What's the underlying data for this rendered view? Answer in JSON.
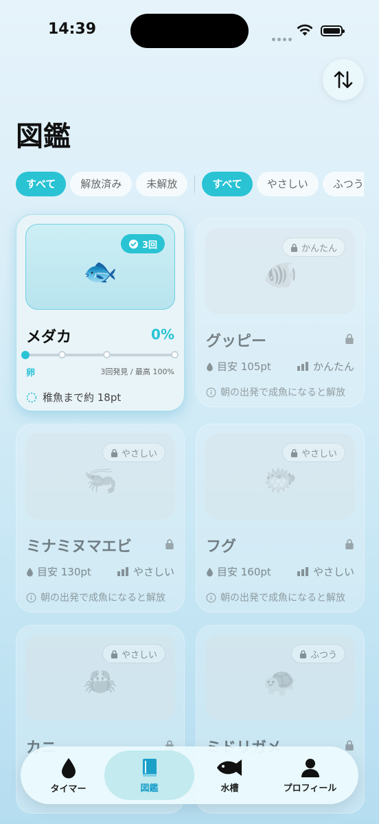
{
  "status_bar": {
    "time": "14:39"
  },
  "page": {
    "title": "図鑑"
  },
  "filters": {
    "status": [
      "すべて",
      "解放済み",
      "未解放"
    ],
    "difficulty": [
      "すべて",
      "やさしい",
      "ふつう"
    ]
  },
  "cards": [
    {
      "name": "メダカ",
      "emoji": "🐟",
      "badge": "3回",
      "percent": "0%",
      "stage": "卵",
      "found_text": "3回発見 / 最高 100%",
      "next_text": "稚魚まで約 18pt",
      "progress": 0
    },
    {
      "name": "グッピー",
      "emoji": "🐠",
      "badge": "かんたん",
      "target": "目安 105pt",
      "difficulty": "かんたん",
      "note": "朝の出発で成魚になると解放"
    },
    {
      "name": "ミナミヌマエビ",
      "emoji": "🦐",
      "badge": "やさしい",
      "target": "目安 130pt",
      "difficulty": "やさしい",
      "note": "朝の出発で成魚になると解放"
    },
    {
      "name": "フグ",
      "emoji": "🐡",
      "badge": "やさしい",
      "target": "目安 160pt",
      "difficulty": "やさしい",
      "note": "朝の出発で成魚になると解放"
    },
    {
      "name": "カニ",
      "emoji": "🦀",
      "badge": "やさしい",
      "target": "",
      "difficulty": "",
      "note": ""
    },
    {
      "name": "ミドリガメ",
      "emoji": "🐢",
      "badge": "ふつう",
      "target": "",
      "difficulty": "",
      "note": ""
    }
  ],
  "nav": [
    {
      "label": "タイマー",
      "icon": "drop-icon"
    },
    {
      "label": "図鑑",
      "icon": "book-icon",
      "active": true
    },
    {
      "label": "水槽",
      "icon": "fish-icon"
    },
    {
      "label": "プロフィール",
      "icon": "person-icon"
    }
  ],
  "colors": {
    "accent": "#29c3d4"
  }
}
